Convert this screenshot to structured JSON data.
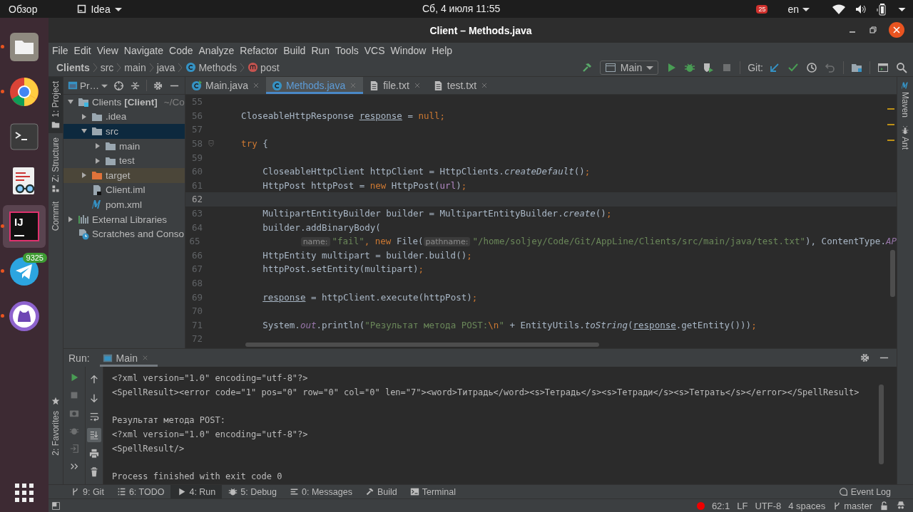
{
  "top_bar": {
    "activities": "Обзор",
    "app_menu": "Idea",
    "clock": "Сб, 4 июля  11:55",
    "notification_count": "25",
    "keyboard_layout": "en"
  },
  "dock": {
    "items": [
      {
        "kind": "files",
        "running": true,
        "selected": false
      },
      {
        "kind": "browser",
        "running": true,
        "selected": false
      },
      {
        "kind": "terminal",
        "running": false,
        "selected": false
      },
      {
        "kind": "viewer",
        "running": false,
        "selected": false
      },
      {
        "kind": "ide",
        "running": true,
        "selected": true,
        "logo_text": "IJ"
      },
      {
        "kind": "messenger",
        "running": true,
        "selected": false,
        "badge": "9325"
      },
      {
        "kind": "desktop-git",
        "running": true,
        "selected": false
      }
    ]
  },
  "window": {
    "title": "Client – Methods.java"
  },
  "menu": [
    "File",
    "Edit",
    "View",
    "Navigate",
    "Code",
    "Analyze",
    "Refactor",
    "Build",
    "Run",
    "Tools",
    "VCS",
    "Window",
    "Help"
  ],
  "breadcrumb": [
    {
      "label": "Clients",
      "kind": "project"
    },
    {
      "label": "src",
      "kind": "dir"
    },
    {
      "label": "main",
      "kind": "dir"
    },
    {
      "label": "java",
      "kind": "dir"
    },
    {
      "label": "Methods",
      "kind": "class"
    },
    {
      "label": "post",
      "kind": "method"
    }
  ],
  "toolbar": {
    "run_config": "Main",
    "git_label": "Git:",
    "buttons": [
      {
        "kind": "build",
        "disabled": false
      },
      {
        "kind": "config"
      },
      {
        "kind": "run",
        "disabled": false
      },
      {
        "kind": "debug",
        "disabled": false
      },
      {
        "kind": "coverage",
        "disabled": false
      },
      {
        "kind": "stop",
        "disabled": true
      },
      {
        "kind": "git"
      },
      {
        "kind": "update",
        "disabled": false
      },
      {
        "kind": "commit",
        "disabled": false
      },
      {
        "kind": "history",
        "disabled": false
      },
      {
        "kind": "rollback",
        "disabled": true
      },
      {
        "kind": "structure",
        "disabled": false
      },
      {
        "kind": "presentation",
        "disabled": false
      },
      {
        "kind": "search",
        "disabled": false
      }
    ]
  },
  "left_stripe": [
    {
      "label": "1: Project",
      "selected": true,
      "kind": "project"
    },
    {
      "label": "Z: Structure",
      "selected": false,
      "kind": "structure"
    },
    {
      "label": "Commit",
      "selected": false,
      "kind": "commit"
    }
  ],
  "favorites_stripe": {
    "label": "2: Favorites"
  },
  "right_stripe": [
    {
      "label": "Maven",
      "kind": "maven"
    },
    {
      "label": "Ant",
      "kind": "ant"
    }
  ],
  "project_panel": {
    "view": "Pr…",
    "tree": [
      {
        "label": "Clients **[Client]**",
        "location": "~/Co",
        "kind": "module",
        "expanded": true,
        "selected": false,
        "children": [
          {
            "label": ".idea",
            "kind": "folder",
            "expanded": false,
            "selected": false
          },
          {
            "label": "src",
            "kind": "folder",
            "expanded": true,
            "selected": true,
            "children": [
              {
                "label": "main",
                "kind": "folder",
                "expanded": false,
                "selected": false
              },
              {
                "label": "test",
                "kind": "folder",
                "expanded": false,
                "selected": false
              }
            ]
          },
          {
            "label": "target",
            "kind": "excluded",
            "expanded": false,
            "selected": false
          },
          {
            "label": "Client.iml",
            "kind": "iml",
            "selected": false
          },
          {
            "label": "pom.xml",
            "kind": "maven",
            "selected": false
          }
        ]
      },
      {
        "label": "External Libraries",
        "kind": "libraries",
        "expanded": false,
        "selected": false
      },
      {
        "label": "Scratches and Conso",
        "kind": "scratches",
        "selected": false
      }
    ]
  },
  "editor_tabs": [
    {
      "label": "Main.java",
      "kind": "runnable-class",
      "selected": false
    },
    {
      "label": "Methods.java",
      "kind": "class",
      "selected": true
    },
    {
      "label": "file.txt",
      "kind": "text",
      "selected": false
    },
    {
      "label": "test.txt",
      "kind": "text",
      "selected": false
    }
  ],
  "code": [
    {
      "number": "55"
    },
    {
      "number": "56",
      "tokens": [
        {
          "text": "    CloseableHttpResponse ",
          "kind": "plain"
        },
        {
          "text": "response",
          "kind": "reassigned"
        },
        {
          "text": " = ",
          "kind": "plain"
        },
        {
          "text": "null",
          "kind": "keyword"
        },
        {
          "text": ";",
          "kind": "keyword"
        }
      ]
    },
    {
      "number": "57"
    },
    {
      "number": "58",
      "fold": true,
      "tokens": [
        {
          "text": "    try",
          "kind": "keyword"
        },
        {
          "text": " {",
          "kind": "plain"
        }
      ]
    },
    {
      "number": "59"
    },
    {
      "number": "60",
      "tokens": [
        {
          "text": "        CloseableHttpClient httpClient = HttpClients.",
          "kind": "plain"
        },
        {
          "text": "createDefault",
          "kind": "static"
        },
        {
          "text": "()",
          "kind": "plain"
        },
        {
          "text": ";",
          "kind": "keyword"
        }
      ]
    },
    {
      "number": "61",
      "tokens": [
        {
          "text": "        HttpPost httpPost = ",
          "kind": "plain"
        },
        {
          "text": "new",
          "kind": "keyword"
        },
        {
          "text": " HttpPost(",
          "kind": "plain"
        },
        {
          "text": "url",
          "kind": "param"
        },
        {
          "text": ")",
          "kind": "plain"
        },
        {
          "text": ";",
          "kind": "keyword"
        }
      ]
    },
    {
      "number": "62",
      "current": true
    },
    {
      "number": "63",
      "tokens": [
        {
          "text": "        MultipartEntityBuilder builder = MultipartEntityBuilder.",
          "kind": "plain"
        },
        {
          "text": "create",
          "kind": "static"
        },
        {
          "text": "()",
          "kind": "plain"
        },
        {
          "text": ";",
          "kind": "keyword"
        }
      ]
    },
    {
      "number": "64",
      "tokens": [
        {
          "text": "        builder.addBinaryBody(",
          "kind": "plain"
        }
      ]
    },
    {
      "number": "65",
      "tokens": [
        {
          "text": "                name:",
          "kind": "hint"
        },
        {
          "text": "\"fail\"",
          "kind": "string"
        },
        {
          "text": ", ",
          "kind": "keyword"
        },
        {
          "text": "new",
          "kind": "keyword"
        },
        {
          "text": " File(",
          "kind": "plain"
        },
        {
          "text": "pathname:",
          "kind": "hint"
        },
        {
          "text": "\"/home/soljey/Code/Git/AppLine/Clients/src/main/java/test.txt\"",
          "kind": "string"
        },
        {
          "text": "), ",
          "kind": "plain"
        },
        {
          "text": "ContentType.",
          "kind": "plain"
        },
        {
          "text": "AP",
          "kind": "static-field"
        }
      ]
    },
    {
      "number": "66",
      "tokens": [
        {
          "text": "        HttpEntity multipart = builder.build()",
          "kind": "plain"
        },
        {
          "text": ";",
          "kind": "keyword"
        }
      ]
    },
    {
      "number": "67",
      "tokens": [
        {
          "text": "        httpPost.setEntity(multipart)",
          "kind": "plain"
        },
        {
          "text": ";",
          "kind": "keyword"
        }
      ]
    },
    {
      "number": "68"
    },
    {
      "number": "69",
      "tokens": [
        {
          "text": "        response",
          "kind": "reassigned"
        },
        {
          "text": " = httpClient.execute(httpPost)",
          "kind": "plain"
        },
        {
          "text": ";",
          "kind": "keyword"
        }
      ]
    },
    {
      "number": "70"
    },
    {
      "number": "71",
      "tokens": [
        {
          "text": "        System.",
          "kind": "plain"
        },
        {
          "text": "out",
          "kind": "static-field"
        },
        {
          "text": ".println(",
          "kind": "plain"
        },
        {
          "text": "\"Результат метода POST:",
          "kind": "string"
        },
        {
          "text": "\\n",
          "kind": "escape"
        },
        {
          "text": "\"",
          "kind": "string"
        },
        {
          "text": " + EntityUtils.",
          "kind": "plain"
        },
        {
          "text": "toString",
          "kind": "static"
        },
        {
          "text": "(",
          "kind": "plain"
        },
        {
          "text": "response",
          "kind": "reassigned"
        },
        {
          "text": ".getEntity()))",
          "kind": "plain"
        },
        {
          "text": ";",
          "kind": "keyword"
        }
      ]
    },
    {
      "number": "72"
    }
  ],
  "run_panel": {
    "label": "Run:",
    "tab": "Main",
    "left_tools": [
      {
        "kind": "rerun",
        "disabled": false
      },
      {
        "kind": "stop",
        "disabled": true
      },
      {
        "kind": "camera",
        "disabled": true
      },
      {
        "kind": "bug",
        "disabled": true
      },
      {
        "kind": "exit",
        "disabled": true
      },
      {
        "kind": "more",
        "disabled": false
      }
    ],
    "right_tools": [
      {
        "kind": "up",
        "selected": false
      },
      {
        "kind": "down",
        "selected": false
      },
      {
        "kind": "wrap",
        "selected": false
      },
      {
        "kind": "scroll-end",
        "selected": true
      },
      {
        "kind": "print",
        "selected": false
      },
      {
        "kind": "trash",
        "selected": false
      }
    ],
    "console": [
      [
        "<?xml version=\"1.0\" encoding=\"utf-8\"?>",
        "<SpellResult><error code=\"1\" pos=\"0\" row=\"0\" col=\"0\" len=\"7\"><word>Титрадь</word><s>Тетрадь</s><s>Тетради</s><s>Тетрать</s></error></SpellResult>"
      ],
      [
        "Результат метода POST:",
        "<?xml version=\"1.0\" encoding=\"utf-8\"?>",
        "<SpellResult/>"
      ],
      [
        "Process finished with exit code 0"
      ]
    ]
  },
  "tool_windows": [
    {
      "label": "9: Git",
      "kind": "git",
      "selected": false
    },
    {
      "label": "6: TODO",
      "kind": "todo",
      "selected": false
    },
    {
      "label": "4: Run",
      "kind": "run",
      "selected": true
    },
    {
      "label": "5: Debug",
      "kind": "debug",
      "selected": false
    },
    {
      "label": "0: Messages",
      "kind": "messages",
      "selected": false
    },
    {
      "label": "Build",
      "kind": "build",
      "selected": false
    },
    {
      "label": "Terminal",
      "kind": "terminal",
      "selected": false
    }
  ],
  "event_log": "Event Log",
  "status_bar": {
    "position": "62:1",
    "line_separator": "LF",
    "encoding": "UTF-8",
    "indent": "4 spaces",
    "branch": "master"
  }
}
